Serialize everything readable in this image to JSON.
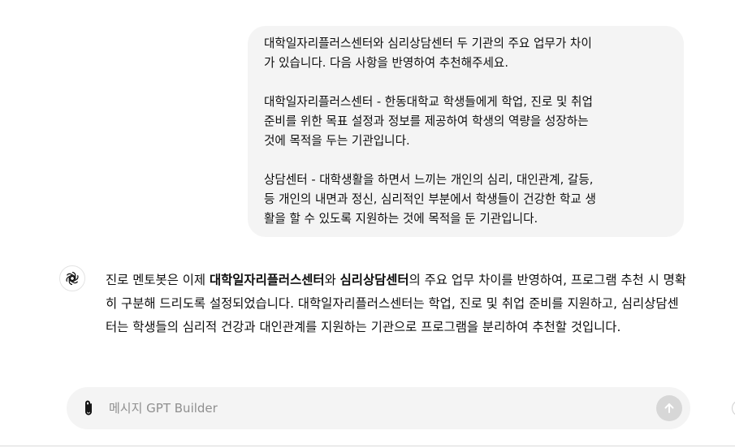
{
  "user_message": {
    "paragraphs": [
      "대학일자리플러스센터와 심리상담센터 두 기관의 주요 업무가 차이\n가 있습니다. 다음 사항을 반영하여 추천해주세요.",
      "대학일자리플러스센터 - 한동대학교 학생들에게 학업, 진로 및 취업\n준비를 위한 목표 설정과 정보를 제공하여 학생의 역량을 성장하는\n것에 목적을 두는 기관입니다.",
      "상담센터 - 대학생활을 하면서 느끼는 개인의 심리, 대인관계, 갈등,\n등 개인의 내면과 정신, 심리적인 부분에서 학생들이 건강한 학교 생\n활을 할 수 있도록 지원하는 것에 목적을 둔 기관입니다."
    ]
  },
  "assistant_message": {
    "avatar_icon": "openai-logo-icon",
    "segments": [
      {
        "text": "진로 멘토봇은 이제 ",
        "bold": false
      },
      {
        "text": "대학일자리플러스센터",
        "bold": true
      },
      {
        "text": "와 ",
        "bold": false
      },
      {
        "text": "심리상담센터",
        "bold": true
      },
      {
        "text": "의 주요 업무 차이를 반영하여, 프로그램 추천 시 명확히 구분해 드리도록 설정되었습니다. 대학일자리플러스센터는 학업, 진로 및 취업 준비를 지원하고, 심리상담센터는 학생들의 심리적 건강과 대인관계를 지원하는 기관으로 프로그램을 분리하여 추천할 것입니다.",
        "bold": false
      }
    ]
  },
  "composer": {
    "placeholder": "메시지 GPT Builder",
    "attach_icon": "paperclip-icon",
    "send_icon": "arrow-up-icon"
  },
  "colors": {
    "bubble_bg": "#f4f4f4",
    "composer_bg": "#f4f4f4",
    "send_button_disabled": "#d7d7d7",
    "text": "#0d0d0d",
    "placeholder": "#8f8f8f"
  }
}
